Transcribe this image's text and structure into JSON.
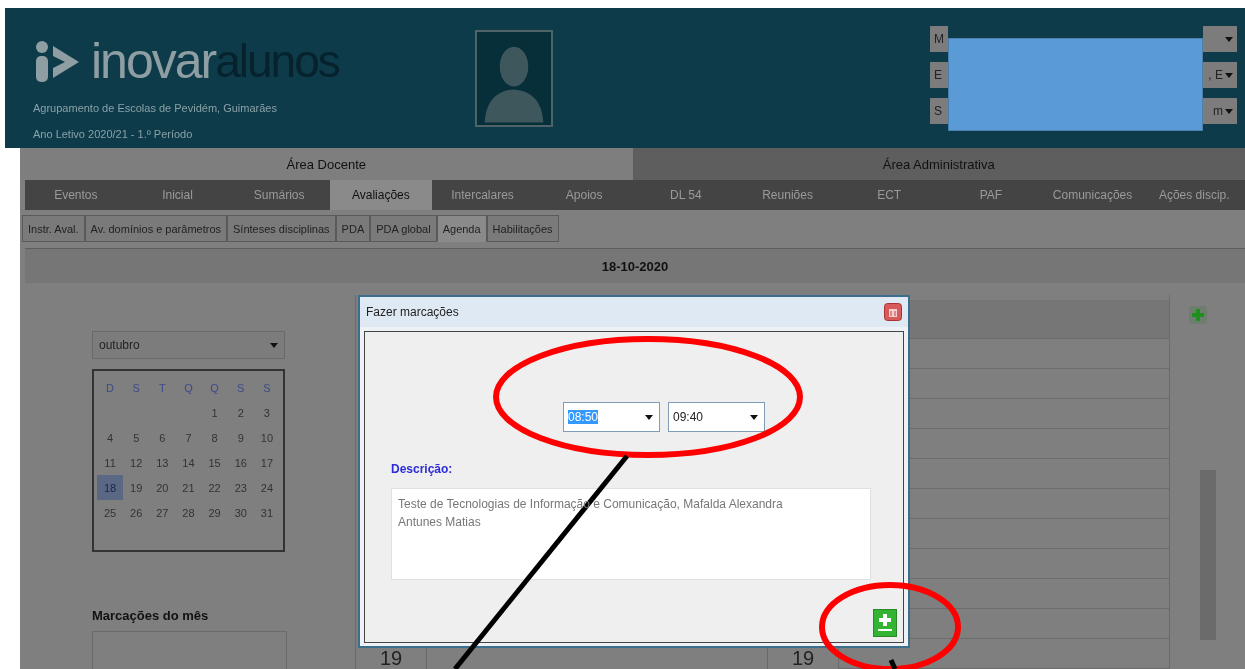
{
  "header": {
    "logo_main": "inovar",
    "logo_accent": "alunos",
    "school": "Agrupamento de Escolas de Pevidém, Guimarães",
    "year": "Ano Letivo 2020/21 - 1.º Período",
    "selectors": [
      {
        "start": "M"
      },
      {
        "start": "E",
        "end": ", E"
      },
      {
        "start": "S",
        "end": "m"
      }
    ]
  },
  "areas": [
    {
      "label": "Área Docente",
      "selected": true
    },
    {
      "label": "Área Administrativa",
      "selected": false
    }
  ],
  "tabs": [
    {
      "label": "Eventos",
      "selected": false
    },
    {
      "label": "Inicial",
      "selected": false
    },
    {
      "label": "Sumários",
      "selected": false
    },
    {
      "label": "Avaliações",
      "selected": true
    },
    {
      "label": "Intercalares",
      "selected": false
    },
    {
      "label": "Apoios",
      "selected": false
    },
    {
      "label": "DL 54",
      "selected": false
    },
    {
      "label": "Reuniões",
      "selected": false
    },
    {
      "label": "ECT",
      "selected": false
    },
    {
      "label": "PAF",
      "selected": false
    },
    {
      "label": "Comunicações",
      "selected": false
    },
    {
      "label": "Ações discip.",
      "selected": false
    }
  ],
  "subtabs": [
    {
      "label": "Instr. Aval.",
      "selected": false
    },
    {
      "label": "Av. domínios e parâmetros",
      "selected": false
    },
    {
      "label": "Sínteses disciplinas",
      "selected": false
    },
    {
      "label": "PDA",
      "selected": false
    },
    {
      "label": "PDA global",
      "selected": false
    },
    {
      "label": "Agenda",
      "selected": true
    },
    {
      "label": "Habilitações",
      "selected": false
    }
  ],
  "date": "18-10-2020",
  "calendar": {
    "month": "outubro",
    "weekdays": [
      "D",
      "S",
      "T",
      "Q",
      "Q",
      "S",
      "S"
    ],
    "weeks": [
      [
        {
          "day": "1",
          "selected": false
        },
        {
          "day": "2",
          "selected": false
        },
        {
          "day": "3",
          "selected": false
        }
      ],
      [
        {
          "day": "4",
          "selected": false
        },
        {
          "day": "5",
          "selected": false
        },
        {
          "day": "6",
          "selected": false
        },
        {
          "day": "7",
          "selected": false
        },
        {
          "day": "8",
          "selected": false
        },
        {
          "day": "9",
          "selected": false
        },
        {
          "day": "10",
          "selected": false
        }
      ],
      [
        {
          "day": "11",
          "selected": false
        },
        {
          "day": "12",
          "selected": false
        },
        {
          "day": "13",
          "selected": false
        },
        {
          "day": "14",
          "selected": false
        },
        {
          "day": "15",
          "selected": false
        },
        {
          "day": "16",
          "selected": false
        },
        {
          "day": "17",
          "selected": false
        }
      ],
      [
        {
          "day": "18",
          "selected": true
        },
        {
          "day": "19",
          "selected": false
        },
        {
          "day": "20",
          "selected": false
        },
        {
          "day": "21",
          "selected": false
        },
        {
          "day": "22",
          "selected": false
        },
        {
          "day": "23",
          "selected": false
        },
        {
          "day": "24",
          "selected": false
        }
      ],
      [
        {
          "day": "25",
          "selected": false
        },
        {
          "day": "26",
          "selected": false
        },
        {
          "day": "27",
          "selected": false
        },
        {
          "day": "28",
          "selected": false
        },
        {
          "day": "29",
          "selected": false
        },
        {
          "day": "30",
          "selected": false
        },
        {
          "day": "31",
          "selected": false
        }
      ]
    ]
  },
  "month_bookings": {
    "title": "Marcações do mês"
  },
  "schedule": {
    "day_labels": [
      "19",
      "19"
    ]
  },
  "dialog": {
    "title": "Fazer marcações",
    "start_time": "08:50",
    "end_time": "09:40",
    "description_label": "Descrição:",
    "description": "Teste de Tecnologias de Informação e Comunicação, Mafalda Alexandra Antunes Matias"
  }
}
